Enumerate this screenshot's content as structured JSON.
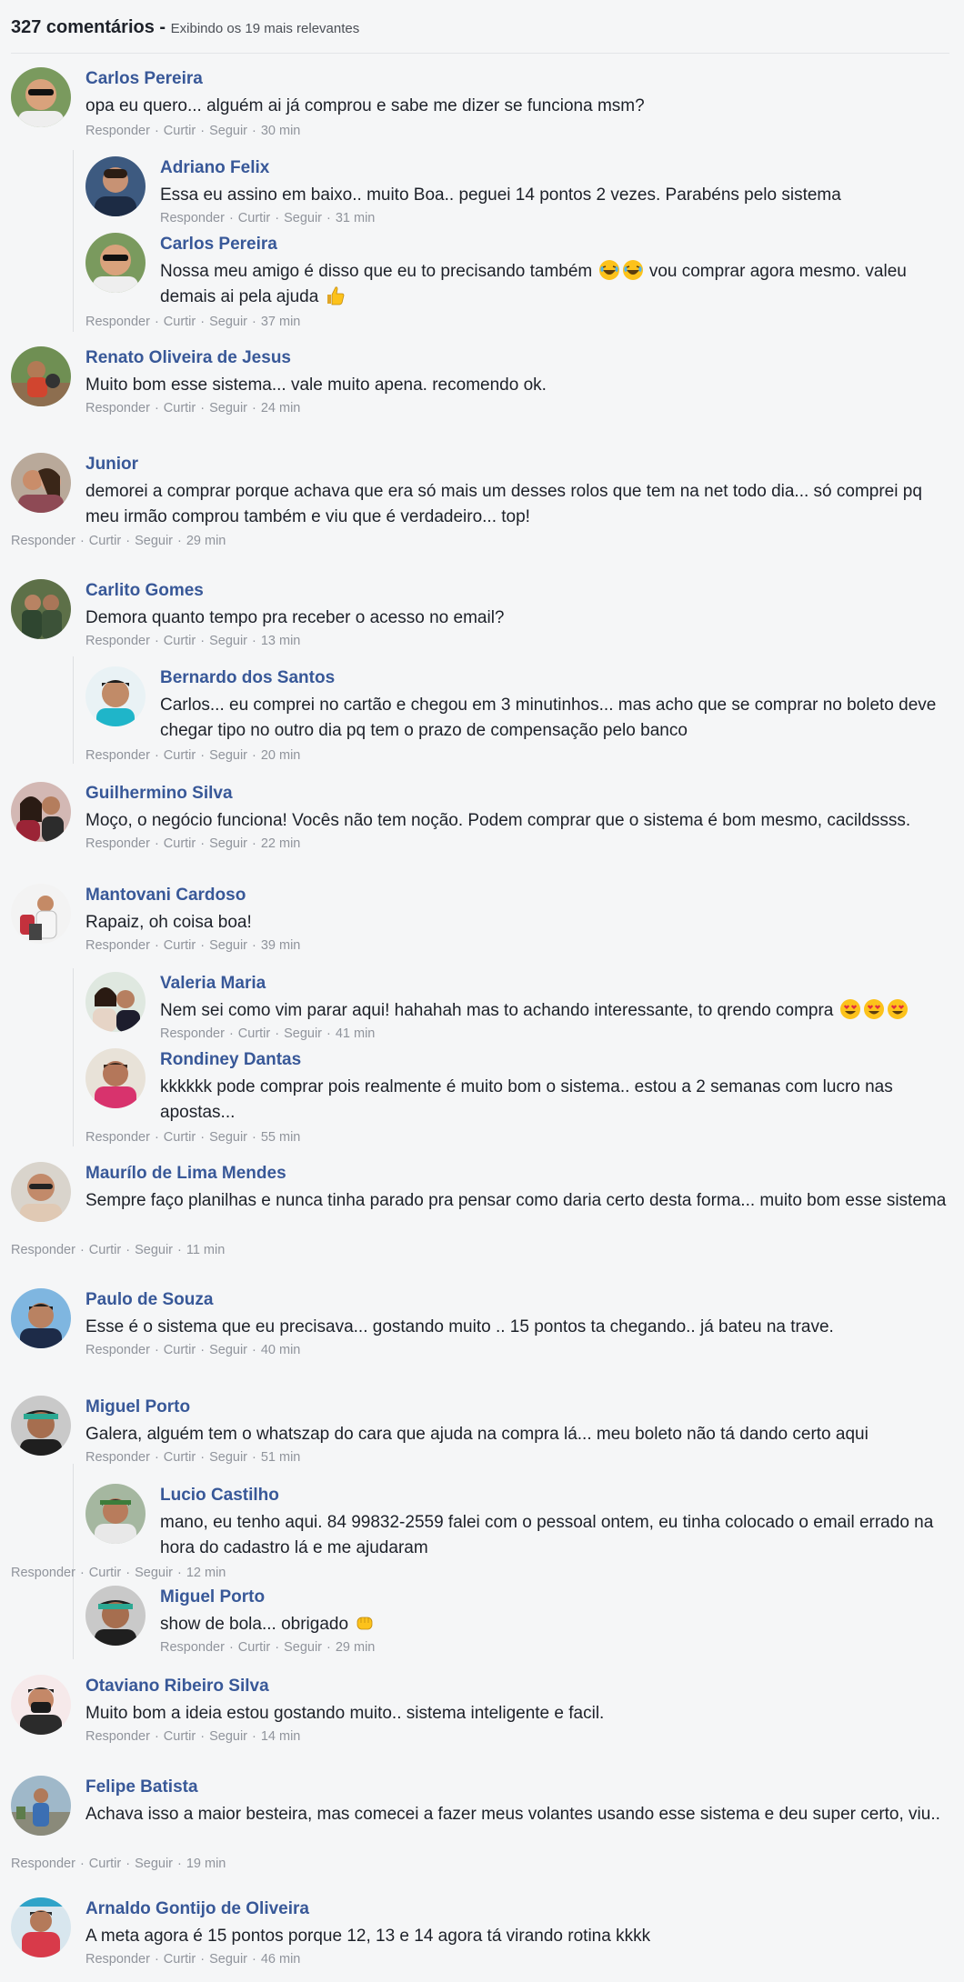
{
  "header": {
    "count": "327 comentários",
    "separator": " - ",
    "subtitle": "Exibindo os 19 mais relevantes"
  },
  "actions": {
    "reply": "Responder",
    "like": "Curtir",
    "follow": "Seguir",
    "sep": "·"
  },
  "comments": [
    {
      "name": "Carlos Pereira",
      "text": "opa eu quero... alguém ai já comprou e sabe me dizer se funciona msm?",
      "time": "30 min"
    },
    {
      "name": "Adriano Felix",
      "text": "Essa eu assino em baixo.. muito Boa.. peguei 14 pontos 2 vezes. Parabéns pelo sistema",
      "time": "31 min"
    },
    {
      "name": "Carlos Pereira",
      "text": "Nossa meu amigo é disso que eu to precisando também",
      "text2": "vou comprar agora mesmo. valeu demais ai pela ajuda",
      "time": "37 min"
    },
    {
      "name": "Renato Oliveira de Jesus",
      "text": "Muito bom esse sistema... vale muito apena. recomendo ok.",
      "time": "24 min"
    },
    {
      "name": "Junior",
      "text": "demorei a comprar porque achava que era só mais um desses rolos que tem na net todo dia... só comprei pq meu irmão comprou também e viu que é verdadeiro... top!",
      "time": "29 min"
    },
    {
      "name": "Carlito Gomes",
      "text": "Demora quanto tempo pra receber o acesso no email?",
      "time": "13 min"
    },
    {
      "name": "Bernardo dos Santos",
      "text": "Carlos... eu comprei no cartão e chegou em 3 minutinhos... mas acho que se comprar no boleto deve chegar tipo no outro dia pq tem o prazo de compensação pelo banco",
      "time": "20 min"
    },
    {
      "name": "Guilhermino Silva",
      "text": "Moço, o negócio funciona! Vocês não tem noção. Podem comprar que o sistema é bom mesmo, cacildssss.",
      "time": "22 min"
    },
    {
      "name": "Mantovani Cardoso",
      "text": "Rapaiz, oh coisa boa!",
      "time": "39 min"
    },
    {
      "name": "Valeria Maria",
      "text": "Nem sei como vim parar aqui! hahahah mas to achando interessante, to qrendo compra",
      "time": "41 min"
    },
    {
      "name": "Rondiney Dantas",
      "text": "kkkkkk pode comprar pois realmente é muito bom o sistema.. estou a 2 semanas com lucro nas apostas...",
      "time": "55 min"
    },
    {
      "name": "Maurílo de Lima Mendes",
      "text": "Sempre faço planilhas e nunca tinha parado pra pensar como daria certo desta forma... muito bom esse sistema",
      "time": "11 min"
    },
    {
      "name": "Paulo de Souza",
      "text": "Esse é o sistema que eu precisava... gostando muito .. 15 pontos ta chegando.. já bateu na trave.",
      "time": "40 min"
    },
    {
      "name": "Miguel Porto",
      "text": "Galera, alguém tem o whatszap do cara que ajuda na compra lá... meu boleto não tá dando certo aqui",
      "time": "51 min"
    },
    {
      "name": "Lucio Castilho",
      "text": "mano, eu tenho aqui. 84 99832-2559 falei com o pessoal ontem, eu tinha colocado o email errado na hora do cadastro lá e me ajudaram",
      "time": "12 min"
    },
    {
      "name": "Miguel Porto",
      "text": "show de bola... obrigado",
      "time": "29 min"
    },
    {
      "name": "Otaviano Ribeiro Silva",
      "text": "Muito bom a ideia estou gostando muito.. sistema inteligente e facil.",
      "time": "14 min"
    },
    {
      "name": "Felipe Batista",
      "text": "Achava isso a maior besteira, mas comecei a fazer meus volantes usando esse sistema e deu super certo, viu..",
      "time": "19 min"
    },
    {
      "name": "Arnaldo Gontijo de Oliveira",
      "text": "A meta agora é 15 pontos porque 12, 13 e 14 agora tá virando rotina kkkk",
      "time": "46 min"
    }
  ]
}
